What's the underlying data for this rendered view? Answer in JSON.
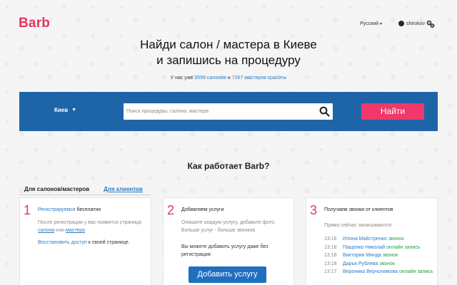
{
  "header": {
    "logo": "Barb",
    "language": "Русский",
    "username": "shirokov",
    "icons": {
      "user": "user-icon",
      "settings": "settings-icon",
      "caret": "chevron-down-icon"
    }
  },
  "hero": {
    "title_line1": "Найди салон / мастера в Киеве",
    "title_line2": "и запишись на процедуру",
    "sub_prefix": "У нас уже",
    "salons_count": "3599 салонов",
    "sub_and": "и",
    "masters_count": "7267 мастеров красоты"
  },
  "search": {
    "city": "Киев",
    "placeholder": "Поиск процедуры, салона, мастера",
    "value": "",
    "button_label": "Найти",
    "icon": "search-icon"
  },
  "how": {
    "title": "Как работает Barb?",
    "tabs": [
      {
        "label": "Для салонов/мастеров",
        "active": true
      },
      {
        "label": "Для клиентов",
        "active": false
      }
    ]
  },
  "steps": [
    {
      "number": "1",
      "head_link": "Регистрируемся",
      "head_text": "бесплатно",
      "text_prefix": "После регистрации у вас появится страница",
      "link_salon": "салона",
      "text_or": "или",
      "link_master": "мастера",
      "restore_link": "Восстановить доступ",
      "restore_text": "к своей странице."
    },
    {
      "number": "2",
      "head_text": "Добавляем услуги",
      "text_1": "Опишите каждую услугу, добавьте фото. Больше услуг - больше звонков.",
      "text_2": "Вы можете добавить услугу даже без регистрации:",
      "button_label": "Добавить услугу"
    },
    {
      "number": "3",
      "head_text": "Получаем звонки от клиентов",
      "live_label": "Прямо сейчас записываются:",
      "calls": [
        {
          "time": "13:18",
          "name": "Илона Майстренко",
          "type": "звонок"
        },
        {
          "time": "13:18",
          "name": "Пащенко Николай",
          "type": "онлайн запись"
        },
        {
          "time": "13:18",
          "name": "Виктория Минда",
          "type": "звонок"
        },
        {
          "time": "13:18",
          "name": "Дарья Рублева",
          "type": "звонок"
        },
        {
          "time": "13:17",
          "name": "Вероника Верчоламова",
          "type": "онлайн запись"
        }
      ]
    }
  ],
  "colors": {
    "brand": "#e8345a",
    "band": "#1e65a8",
    "find_button": "#f0386a",
    "link": "#2a7cc7",
    "call_type": "#25a046"
  }
}
